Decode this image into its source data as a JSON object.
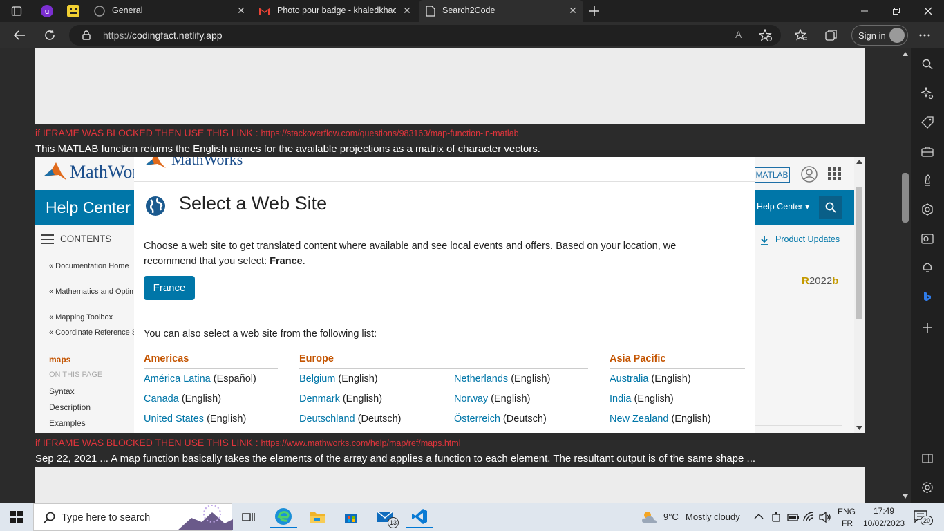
{
  "browser": {
    "tabs": [
      {
        "title": "General"
      },
      {
        "title": "Photo pour badge - khaledkhaou"
      },
      {
        "title": "Search2Code"
      }
    ],
    "url_prefix": "https://",
    "url_host": "codingfact.netlify.app",
    "signin_label": "Sign in",
    "read_aloud_label": "A"
  },
  "page": {
    "blocked_prefix": "if IFRAME WAS BLOCKED THEN USE THIS LINK : ",
    "link1": "https://stackoverflow.com/questions/983163/map-function-in-matlab",
    "desc1": "This MATLAB function returns the English names for the available projections as a matrix of character vectors.",
    "link2": "https://www.mathworks.com/help/map/ref/maps.html",
    "desc2": "Sep 22, 2021 ... A map function basically takes the elements of the array and applies a function to each element. The resultant output is of the same shape ..."
  },
  "mathworks": {
    "logo_text": "MathWorks",
    "header_matlab": "MATLAB",
    "help_center": "Help Center",
    "help_center_dropdown": "Help Center",
    "contents": "CONTENTS",
    "product_updates": "Product Updates",
    "release_r": "R",
    "release_year": "2022",
    "release_b": "b",
    "sidebar": {
      "doc_home": "« Documentation Home",
      "math": "« Mathematics and Optim",
      "mapping": "« Mapping Toolbox",
      "coord": "« Coordinate Reference S",
      "current": "maps",
      "on_this_page": "ON THIS PAGE",
      "syntax": "Syntax",
      "description": "Description",
      "examples": "Examples"
    }
  },
  "dialog": {
    "logo_text": "MathWorks",
    "title": "Select a Web Site",
    "intro": "Choose a web site to get translated content where available and see local events and offers. Based on your location, we recommend that you select: ",
    "recommended": "France",
    "intro_end": ".",
    "button": "France",
    "also": "You can also select a web site from the following list:",
    "regions": {
      "americas": "Americas",
      "europe": "Europe",
      "asia": "Asia Pacific"
    },
    "sites": [
      {
        "name": "América Latina",
        "lang": " (Español)"
      },
      {
        "name": "Canada",
        "lang": " (English)"
      },
      {
        "name": "United States",
        "lang": " (English)"
      },
      {
        "name": "Belgium",
        "lang": " (English)"
      },
      {
        "name": "Denmark",
        "lang": " (English)"
      },
      {
        "name": "Deutschland",
        "lang": " (Deutsch)"
      },
      {
        "name": "Netherlands",
        "lang": " (English)"
      },
      {
        "name": "Norway",
        "lang": " (English)"
      },
      {
        "name": "Österreich",
        "lang": " (Deutsch)"
      },
      {
        "name": "Australia",
        "lang": " (English)"
      },
      {
        "name": "India",
        "lang": " (English)"
      },
      {
        "name": "New Zealand",
        "lang": " (English)"
      }
    ]
  },
  "taskbar": {
    "search_placeholder": "Type here to search",
    "weather_temp": "9°C",
    "weather_text": "Mostly cloudy",
    "lang_1": "ENG",
    "lang_2": "FR",
    "time": "17:49",
    "date": "10/02/2023",
    "mail_badge": "13",
    "notif_badge": "20"
  },
  "colors": {
    "accent": "#0076a8",
    "blocked_red": "#e0343b",
    "region_orange": "#c45400"
  }
}
